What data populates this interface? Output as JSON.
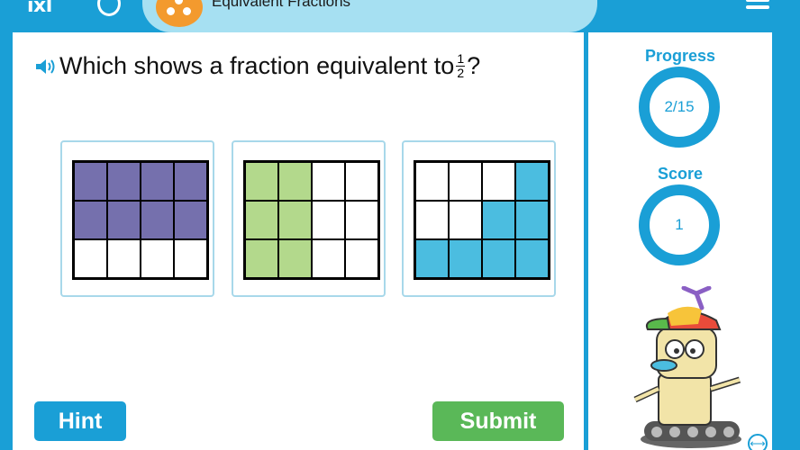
{
  "header": {
    "logo": "IXL",
    "skill_title": "Equivalent Fractions"
  },
  "question": {
    "text": "Which shows a fraction equivalent to",
    "fraction": {
      "numerator": "1",
      "denominator": "2"
    },
    "end": "?"
  },
  "choices": [
    {
      "rows": 3,
      "cols": 4,
      "shaded_cells": [
        0,
        1,
        2,
        3,
        4,
        5,
        6,
        7
      ],
      "color": "#7570ad"
    },
    {
      "rows": 3,
      "cols": 4,
      "shaded_cells": [
        0,
        1,
        4,
        5,
        8,
        9
      ],
      "color": "#b3d98c"
    },
    {
      "rows": 3,
      "cols": 4,
      "shaded_cells": [
        3,
        6,
        7,
        8,
        9,
        10,
        11
      ],
      "color": "#4bbde0"
    }
  ],
  "buttons": {
    "hint": "Hint",
    "submit": "Submit"
  },
  "sidebar": {
    "progress_label": "Progress",
    "progress_value": "2/15",
    "score_label": "Score",
    "score_value": "1"
  },
  "icons": {
    "speaker": "speaker-icon",
    "menu": "hamburger-menu-icon",
    "expand": "expand-arrows-icon"
  },
  "colors": {
    "brand_blue": "#1a9fd6",
    "submit_green": "#5ab858",
    "skill_orange": "#f39a2e"
  }
}
